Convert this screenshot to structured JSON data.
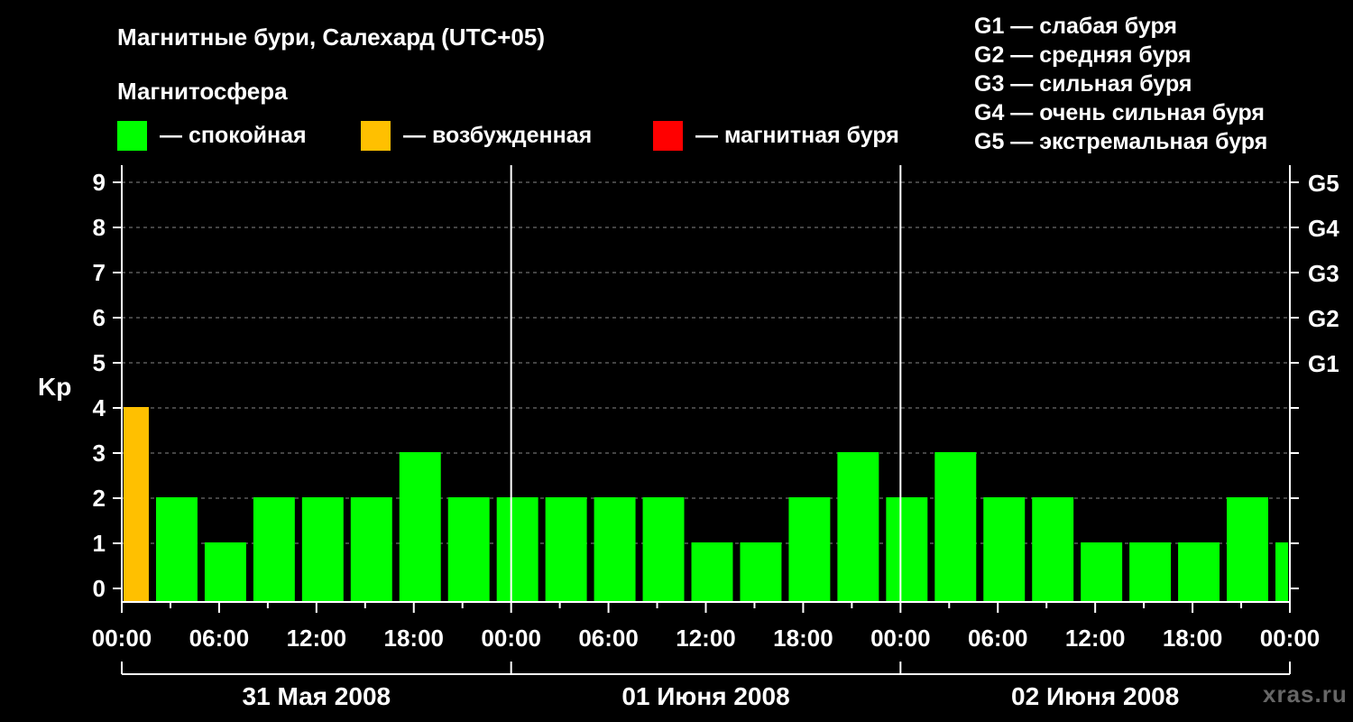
{
  "chart_data": {
    "type": "bar",
    "title": "Магнитные бури, Салехард (UTC+05)",
    "subtitle": "Магнитосфера",
    "ylabel": "Kp",
    "ylim": [
      0,
      9
    ],
    "yticks": [
      0,
      1,
      2,
      3,
      4,
      5,
      6,
      7,
      8,
      9
    ],
    "g_ticks": [
      {
        "kp": 5,
        "label": "G1"
      },
      {
        "kp": 6,
        "label": "G2"
      },
      {
        "kp": 7,
        "label": "G3"
      },
      {
        "kp": 8,
        "label": "G4"
      },
      {
        "kp": 9,
        "label": "G5"
      }
    ],
    "x_tick_labels": [
      "00:00",
      "06:00",
      "12:00",
      "18:00",
      "00:00",
      "06:00",
      "12:00",
      "18:00",
      "00:00",
      "06:00",
      "12:00",
      "18:00",
      "00:00"
    ],
    "dates": [
      "31 Мая 2008",
      "01 Июня 2008",
      "02 Июня 2008"
    ],
    "bar_interval_hours": 3,
    "values": [
      4,
      2,
      1,
      2,
      2,
      2,
      3,
      2,
      2,
      2,
      2,
      2,
      1,
      1,
      2,
      3,
      2,
      3,
      2,
      2,
      1,
      1,
      1,
      2,
      1
    ],
    "legend": [
      {
        "label": "— спокойная",
        "color": "#00ff00"
      },
      {
        "label": "— возбужденная",
        "color": "#ffc000"
      },
      {
        "label": "— магнитная буря",
        "color": "#ff0000"
      }
    ],
    "g_scale": [
      "G1 — слабая буря",
      "G2 — средняя буря",
      "G3 — сильная буря",
      "G4 — очень сильная буря",
      "G5 — экстремальная буря"
    ],
    "colors": {
      "calm": "#00ff00",
      "excited": "#ffc000",
      "storm": "#ff0000",
      "background": "#000000",
      "grid": "#888888"
    },
    "grid": true,
    "watermark": "xras.ru"
  }
}
